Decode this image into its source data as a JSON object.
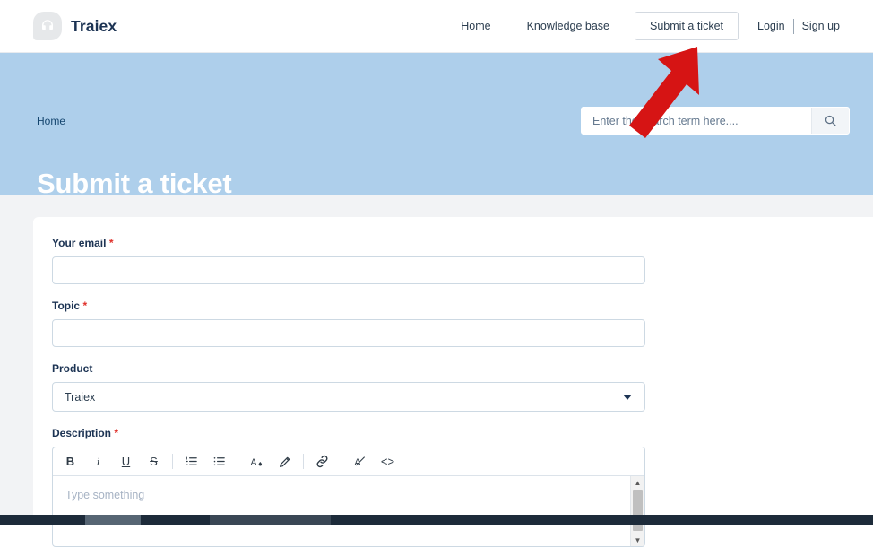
{
  "brand": {
    "name": "Traiex",
    "logo_icon": "headset-icon"
  },
  "nav": {
    "links": [
      {
        "label": "Home"
      },
      {
        "label": "Knowledge base"
      }
    ],
    "submit_ticket_button": "Submit a ticket",
    "login_label": "Login",
    "signup_label": "Sign up"
  },
  "banner": {
    "breadcrumb": "Home",
    "title": "Submit a ticket",
    "background_color": "#aecfeb"
  },
  "search": {
    "placeholder": "Enter the search term here....",
    "value": "",
    "button_icon": "search-icon"
  },
  "form": {
    "email": {
      "label": "Your email",
      "required_marker": "*",
      "value": "",
      "placeholder": ""
    },
    "topic": {
      "label": "Topic",
      "required_marker": "*",
      "value": "",
      "placeholder": ""
    },
    "product": {
      "label": "Product",
      "selected": "Traiex",
      "options": [
        "Traiex"
      ]
    },
    "description": {
      "label": "Description",
      "required_marker": "*",
      "placeholder": "Type something",
      "value": ""
    }
  },
  "editor_toolbar": {
    "buttons": [
      {
        "name": "bold-icon",
        "glyph": "B"
      },
      {
        "name": "italic-icon",
        "glyph": "i"
      },
      {
        "name": "underline-icon",
        "glyph": "U"
      },
      {
        "name": "strikethrough-icon",
        "glyph": "S"
      },
      {
        "name": "ordered-list-icon",
        "glyph": "≣"
      },
      {
        "name": "unordered-list-icon",
        "glyph": "≣"
      },
      {
        "name": "text-color-icon",
        "glyph": "A"
      },
      {
        "name": "highlighter-icon",
        "glyph": "✎"
      },
      {
        "name": "link-icon",
        "glyph": "⚭"
      },
      {
        "name": "clear-formatting-icon",
        "glyph": "A"
      },
      {
        "name": "code-icon",
        "glyph": "<>"
      }
    ]
  },
  "colors": {
    "banner": "#aecfeb",
    "label_text": "#1c3353",
    "required_red": "#e0312b",
    "page_background": "#f2f3f5",
    "arrow": "#d61414",
    "taskbar": "#1d2b3a"
  },
  "pointer": {
    "icon": "red-arrow-icon",
    "points_to": "Submit a ticket"
  }
}
